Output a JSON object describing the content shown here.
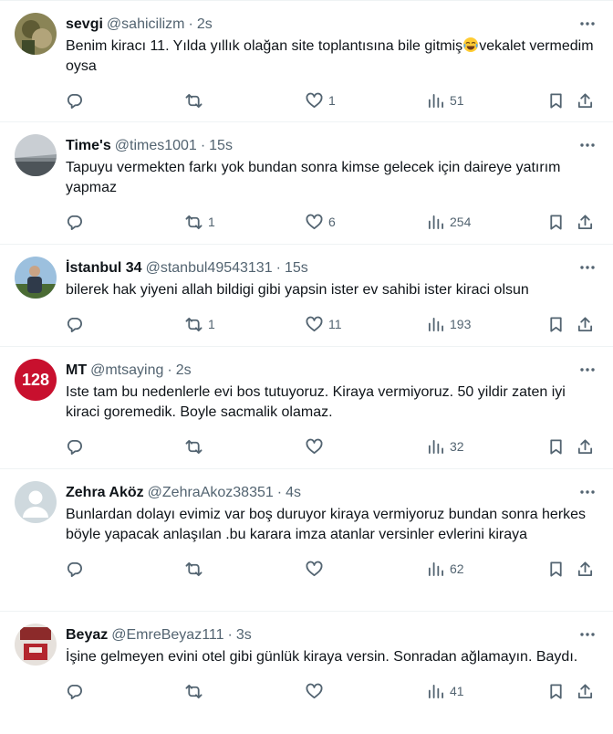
{
  "tweets": [
    {
      "name": "sevgi",
      "handle": "@sahicilizm",
      "time": "2s",
      "text_before": "Benim kiracı 11. Yılda yıllık olağan site toplantısına bile gitmiş",
      "emoji": "face-with-tears-of-joy",
      "text_after": "vekalet vermedim oysa",
      "replies": "",
      "retweets": "",
      "likes": "1",
      "views": "51",
      "avatar_colors": [
        "#6b6a3c",
        "#a99a6c"
      ]
    },
    {
      "name": "Time's",
      "handle": "@times1001",
      "time": "15s",
      "text": "Tapuyu vermekten farkı yok bundan sonra kimse gelecek için daireye yatırım yapmaz",
      "replies": "",
      "retweets": "1",
      "likes": "6",
      "views": "254",
      "avatar_colors": [
        "#c9ced3",
        "#5b6166"
      ]
    },
    {
      "name": "İstanbul 34",
      "handle": "@stanbul49543131",
      "time": "15s",
      "text": "bilerek hak yiyeni allah bildigi gibi yapsin ister ev sahibi ister kiraci olsun",
      "replies": "",
      "retweets": "1",
      "likes": "11",
      "views": "193",
      "avatar_colors": [
        "#7aa0c4",
        "#3d5a2a"
      ]
    },
    {
      "name": "MT",
      "handle": "@mtsaying",
      "time": "2s",
      "text": "Iste tam bu nedenlerle evi bos tutuyoruz. Kiraya vermiyoruz. 50 yildir zaten iyi kiraci goremedik. Boyle sacmalik olamaz.",
      "replies": "",
      "retweets": "",
      "likes": "",
      "views": "32",
      "avatar_text": "128",
      "avatar_colors": [
        "#c8102e",
        "#ffffff"
      ]
    },
    {
      "name": "Zehra Aköz",
      "handle": "@ZehraAkoz38351",
      "time": "4s",
      "text": "Bunlardan dolayı evimiz var boş duruyor kiraya vermiyoruz bundan sonra herkes böyle yapacak anlaşılan .bu karara imza atanlar versinler evlerini kiraya",
      "replies": "",
      "retweets": "",
      "likes": "",
      "views": "62",
      "avatar_colors": [
        "#cfd9de",
        "#ffffff"
      ]
    },
    {
      "name": "Beyaz",
      "handle": "@EmreBeyaz111",
      "time": "3s",
      "text": "İşine gelmeyen evini otel gibi günlük kiraya versin. Sonradan ağlamayın. Baydı.",
      "replies": "",
      "retweets": "",
      "likes": "",
      "views": "41",
      "avatar_colors": [
        "#e6e1dc",
        "#b3262e"
      ]
    }
  ],
  "icons": {
    "reply": "reply-icon",
    "retweet": "retweet-icon",
    "like": "heart-icon",
    "views": "views-icon",
    "bookmark": "bookmark-icon",
    "share": "share-icon",
    "more": "more-dots-icon"
  },
  "colors": {
    "text": "#0f1419",
    "secondary": "#536471",
    "divider": "#eff3f4"
  }
}
